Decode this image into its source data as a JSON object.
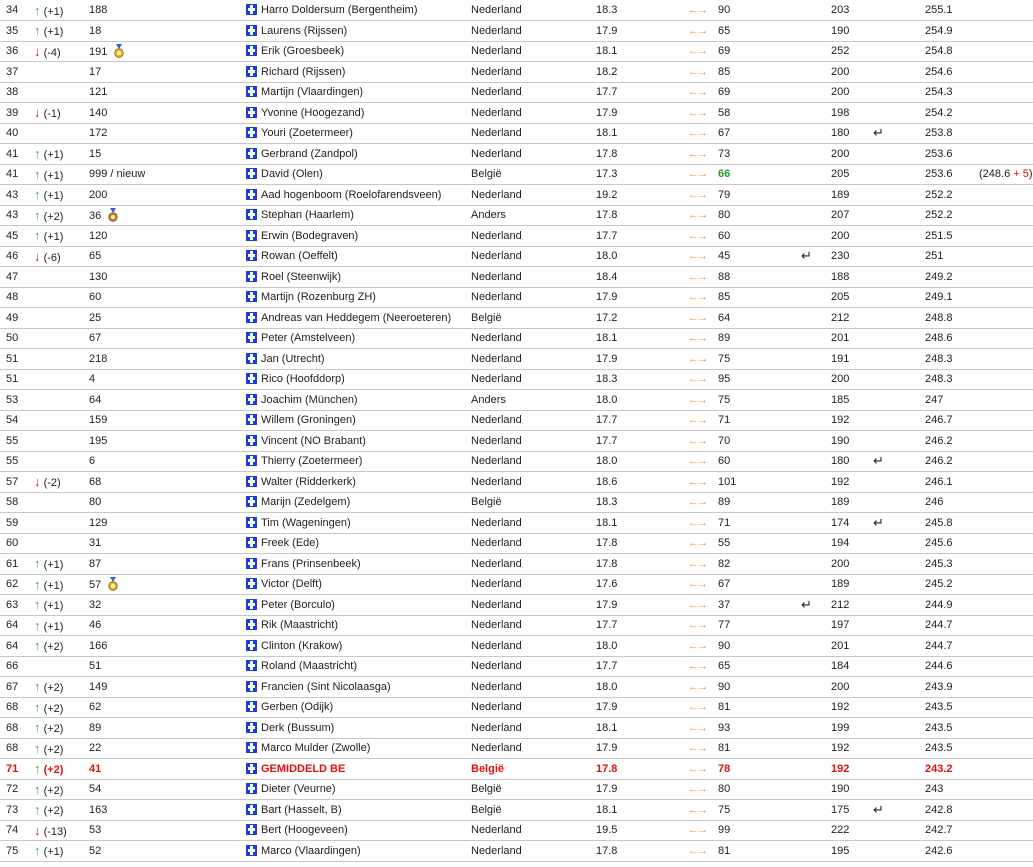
{
  "icons": {
    "up": "arrow-up-icon",
    "down": "arrow-down-icon",
    "flag": "flag-icon",
    "swap": "swap-arrows-icon",
    "return": "return-icon",
    "medal": "medal-icon"
  },
  "colors": {
    "up": "#3db43d",
    "down": "#d42020",
    "highlight": "#e01010",
    "swap": "#f29322",
    "flag": "#1b3fd6"
  },
  "rows": [
    {
      "rank": "34",
      "dir": "up",
      "change": "(+1)",
      "num": "188",
      "medal": "",
      "name": "Harro Doldersum (Bergentheim)",
      "country": "Nederland",
      "v1": "18.3",
      "v2": "90",
      "ret1": false,
      "v3": "203",
      "ret2": false,
      "score": "255.1",
      "extra": "",
      "hl": false
    },
    {
      "rank": "35",
      "dir": "up",
      "change": "(+1)",
      "num": "18",
      "medal": "",
      "name": "Laurens (Rijssen)",
      "country": "Nederland",
      "v1": "17.9",
      "v2": "65",
      "ret1": false,
      "v3": "190",
      "ret2": false,
      "score": "254.9",
      "extra": "",
      "hl": false
    },
    {
      "rank": "36",
      "dir": "down",
      "change": "(-4)",
      "num": "191",
      "medal": "gold",
      "name": "Erik (Groesbeek)",
      "country": "Nederland",
      "v1": "18.1",
      "v2": "69",
      "ret1": false,
      "v3": "252",
      "ret2": false,
      "score": "254.8",
      "extra": "",
      "hl": false
    },
    {
      "rank": "37",
      "dir": "",
      "change": "",
      "num": "17",
      "medal": "",
      "name": "Richard (Rijssen)",
      "country": "Nederland",
      "v1": "18.2",
      "v2": "85",
      "ret1": false,
      "v3": "200",
      "ret2": false,
      "score": "254.6",
      "extra": "",
      "hl": false
    },
    {
      "rank": "38",
      "dir": "",
      "change": "",
      "num": "121",
      "medal": "",
      "name": "Martijn (Vlaardingen)",
      "country": "Nederland",
      "v1": "17.7",
      "v2": "69",
      "ret1": false,
      "v3": "200",
      "ret2": false,
      "score": "254.3",
      "extra": "",
      "hl": false
    },
    {
      "rank": "39",
      "dir": "down",
      "change": "(-1)",
      "num": "140",
      "medal": "",
      "name": "Yvonne (Hoogezand)",
      "country": "Nederland",
      "v1": "17.9",
      "v2": "58",
      "ret1": false,
      "v3": "198",
      "ret2": false,
      "score": "254.2",
      "extra": "",
      "hl": false
    },
    {
      "rank": "40",
      "dir": "",
      "change": "",
      "num": "172",
      "medal": "",
      "name": "Youri (Zoetermeer)",
      "country": "Nederland",
      "v1": "18.1",
      "v2": "67",
      "ret1": false,
      "v3": "180",
      "ret2": true,
      "score": "253.8",
      "extra": "",
      "hl": false
    },
    {
      "rank": "41",
      "dir": "up",
      "change": "(+1)",
      "num": "15",
      "medal": "",
      "name": "Gerbrand (Zandpol)",
      "country": "Nederland",
      "v1": "17.8",
      "v2": "73",
      "ret1": false,
      "v3": "200",
      "ret2": false,
      "score": "253.6",
      "extra": "",
      "hl": false
    },
    {
      "rank": "41",
      "dir": "up",
      "change": "(+1)",
      "num": "999 / nieuw",
      "medal": "",
      "name": "David (Olen)",
      "country": "België",
      "v1": "17.3",
      "v2": "66",
      "ret1": false,
      "v3": "205",
      "ret2": false,
      "score": "253.6",
      "extra": "(248.6 + 5)",
      "hl": false,
      "v2green": true
    },
    {
      "rank": "43",
      "dir": "up",
      "change": "(+1)",
      "num": "200",
      "medal": "",
      "name": "Aad hogenboom (Roelofarendsveen)",
      "country": "Nederland",
      "v1": "19.2",
      "v2": "79",
      "ret1": false,
      "v3": "189",
      "ret2": false,
      "score": "252.2",
      "extra": "",
      "hl": false
    },
    {
      "rank": "43",
      "dir": "up",
      "change": "(+2)",
      "num": "36",
      "medal": "bronze",
      "name": "Stephan (Haarlem)",
      "country": "Anders",
      "v1": "17.8",
      "v2": "80",
      "ret1": false,
      "v3": "207",
      "ret2": false,
      "score": "252.2",
      "extra": "",
      "hl": false
    },
    {
      "rank": "45",
      "dir": "up",
      "change": "(+1)",
      "num": "120",
      "medal": "",
      "name": "Erwin (Bodegraven)",
      "country": "Nederland",
      "v1": "17.7",
      "v2": "60",
      "ret1": false,
      "v3": "200",
      "ret2": false,
      "score": "251.5",
      "extra": "",
      "hl": false
    },
    {
      "rank": "46",
      "dir": "down",
      "change": "(-6)",
      "num": "65",
      "medal": "",
      "name": "Rowan (Oeffelt)",
      "country": "Nederland",
      "v1": "18.0",
      "v2": "45",
      "ret1": true,
      "v3": "230",
      "ret2": false,
      "score": "251",
      "extra": "",
      "hl": false
    },
    {
      "rank": "47",
      "dir": "",
      "change": "",
      "num": "130",
      "medal": "",
      "name": "Roel (Steenwijk)",
      "country": "Nederland",
      "v1": "18.4",
      "v2": "88",
      "ret1": false,
      "v3": "188",
      "ret2": false,
      "score": "249.2",
      "extra": "",
      "hl": false
    },
    {
      "rank": "48",
      "dir": "",
      "change": "",
      "num": "60",
      "medal": "",
      "name": "Martijn (Rozenburg ZH)",
      "country": "Nederland",
      "v1": "17.9",
      "v2": "85",
      "ret1": false,
      "v3": "205",
      "ret2": false,
      "score": "249.1",
      "extra": "",
      "hl": false
    },
    {
      "rank": "49",
      "dir": "",
      "change": "",
      "num": "25",
      "medal": "",
      "name": "Andreas van Heddegem (Neeroeteren)",
      "country": "België",
      "v1": "17.2",
      "v2": "64",
      "ret1": false,
      "v3": "212",
      "ret2": false,
      "score": "248.8",
      "extra": "",
      "hl": false
    },
    {
      "rank": "50",
      "dir": "",
      "change": "",
      "num": "67",
      "medal": "",
      "name": "Peter (Amstelveen)",
      "country": "Nederland",
      "v1": "18.1",
      "v2": "89",
      "ret1": false,
      "v3": "201",
      "ret2": false,
      "score": "248.6",
      "extra": "",
      "hl": false
    },
    {
      "rank": "51",
      "dir": "",
      "change": "",
      "num": "218",
      "medal": "",
      "name": "Jan (Utrecht)",
      "country": "Nederland",
      "v1": "17.9",
      "v2": "75",
      "ret1": false,
      "v3": "191",
      "ret2": false,
      "score": "248.3",
      "extra": "",
      "hl": false
    },
    {
      "rank": "51",
      "dir": "",
      "change": "",
      "num": "4",
      "medal": "",
      "name": "Rico (Hoofddorp)",
      "country": "Nederland",
      "v1": "18.3",
      "v2": "95",
      "ret1": false,
      "v3": "200",
      "ret2": false,
      "score": "248.3",
      "extra": "",
      "hl": false
    },
    {
      "rank": "53",
      "dir": "",
      "change": "",
      "num": "64",
      "medal": "",
      "name": "Joachim (München)",
      "country": "Anders",
      "v1": "18.0",
      "v2": "75",
      "ret1": false,
      "v3": "185",
      "ret2": false,
      "score": "247",
      "extra": "",
      "hl": false
    },
    {
      "rank": "54",
      "dir": "",
      "change": "",
      "num": "159",
      "medal": "",
      "name": "Willem (Groningen)",
      "country": "Nederland",
      "v1": "17.7",
      "v2": "71",
      "ret1": false,
      "v3": "192",
      "ret2": false,
      "score": "246.7",
      "extra": "",
      "hl": false
    },
    {
      "rank": "55",
      "dir": "",
      "change": "",
      "num": "195",
      "medal": "",
      "name": "Vincent (NO Brabant)",
      "country": "Nederland",
      "v1": "17.7",
      "v2": "70",
      "ret1": false,
      "v3": "190",
      "ret2": false,
      "score": "246.2",
      "extra": "",
      "hl": false
    },
    {
      "rank": "55",
      "dir": "",
      "change": "",
      "num": "6",
      "medal": "",
      "name": "Thierry (Zoetermeer)",
      "country": "Nederland",
      "v1": "18.0",
      "v2": "60",
      "ret1": false,
      "v3": "180",
      "ret2": true,
      "score": "246.2",
      "extra": "",
      "hl": false
    },
    {
      "rank": "57",
      "dir": "down",
      "change": "(-2)",
      "num": "68",
      "medal": "",
      "name": "Walter (Ridderkerk)",
      "country": "Nederland",
      "v1": "18.6",
      "v2": "101",
      "ret1": false,
      "v3": "192",
      "ret2": false,
      "score": "246.1",
      "extra": "",
      "hl": false
    },
    {
      "rank": "58",
      "dir": "",
      "change": "",
      "num": "80",
      "medal": "",
      "name": "Marijn (Zedelgem)",
      "country": "België",
      "v1": "18.3",
      "v2": "89",
      "ret1": false,
      "v3": "189",
      "ret2": false,
      "score": "246",
      "extra": "",
      "hl": false
    },
    {
      "rank": "59",
      "dir": "",
      "change": "",
      "num": "129",
      "medal": "",
      "name": "Tim (Wageningen)",
      "country": "Nederland",
      "v1": "18.1",
      "v2": "71",
      "ret1": false,
      "v3": "174",
      "ret2": true,
      "score": "245.8",
      "extra": "",
      "hl": false
    },
    {
      "rank": "60",
      "dir": "",
      "change": "",
      "num": "31",
      "medal": "",
      "name": "Freek (Ede)",
      "country": "Nederland",
      "v1": "17.8",
      "v2": "55",
      "ret1": false,
      "v3": "194",
      "ret2": false,
      "score": "245.6",
      "extra": "",
      "hl": false
    },
    {
      "rank": "61",
      "dir": "up",
      "change": "(+1)",
      "num": "87",
      "medal": "",
      "name": "Frans (Prinsenbeek)",
      "country": "Nederland",
      "v1": "17.8",
      "v2": "82",
      "ret1": false,
      "v3": "200",
      "ret2": false,
      "score": "245.3",
      "extra": "",
      "hl": false
    },
    {
      "rank": "62",
      "dir": "up",
      "change": "(+1)",
      "num": "57",
      "medal": "gold",
      "name": "Victor (Delft)",
      "country": "Nederland",
      "v1": "17.6",
      "v2": "67",
      "ret1": false,
      "v3": "189",
      "ret2": false,
      "score": "245.2",
      "extra": "",
      "hl": false
    },
    {
      "rank": "63",
      "dir": "up",
      "change": "(+1)",
      "num": "32",
      "medal": "",
      "name": "Peter (Borculo)",
      "country": "Nederland",
      "v1": "17.9",
      "v2": "37",
      "ret1": true,
      "v3": "212",
      "ret2": false,
      "score": "244.9",
      "extra": "",
      "hl": false
    },
    {
      "rank": "64",
      "dir": "up",
      "change": "(+1)",
      "num": "46",
      "medal": "",
      "name": "Rik (Maastricht)",
      "country": "Nederland",
      "v1": "17.7",
      "v2": "77",
      "ret1": false,
      "v3": "197",
      "ret2": false,
      "score": "244.7",
      "extra": "",
      "hl": false
    },
    {
      "rank": "64",
      "dir": "up",
      "change": "(+2)",
      "num": "166",
      "medal": "",
      "name": "Clinton (Krakow)",
      "country": "Nederland",
      "v1": "18.0",
      "v2": "90",
      "ret1": false,
      "v3": "201",
      "ret2": false,
      "score": "244.7",
      "extra": "",
      "hl": false
    },
    {
      "rank": "66",
      "dir": "",
      "change": "",
      "num": "51",
      "medal": "",
      "name": "Roland (Maastricht)",
      "country": "Nederland",
      "v1": "17.7",
      "v2": "65",
      "ret1": false,
      "v3": "184",
      "ret2": false,
      "score": "244.6",
      "extra": "",
      "hl": false
    },
    {
      "rank": "67",
      "dir": "up",
      "change": "(+2)",
      "num": "149",
      "medal": "",
      "name": "Francien (Sint Nicolaasga)",
      "country": "Nederland",
      "v1": "18.0",
      "v2": "90",
      "ret1": false,
      "v3": "200",
      "ret2": false,
      "score": "243.9",
      "extra": "",
      "hl": false
    },
    {
      "rank": "68",
      "dir": "up",
      "change": "(+2)",
      "num": "62",
      "medal": "",
      "name": "Gerben (Odijk)",
      "country": "Nederland",
      "v1": "17.9",
      "v2": "81",
      "ret1": false,
      "v3": "192",
      "ret2": false,
      "score": "243.5",
      "extra": "",
      "hl": false
    },
    {
      "rank": "68",
      "dir": "up",
      "change": "(+2)",
      "num": "89",
      "medal": "",
      "name": "Derk (Bussum)",
      "country": "Nederland",
      "v1": "18.1",
      "v2": "93",
      "ret1": false,
      "v3": "199",
      "ret2": false,
      "score": "243.5",
      "extra": "",
      "hl": false
    },
    {
      "rank": "68",
      "dir": "up",
      "change": "(+2)",
      "num": "22",
      "medal": "",
      "name": "Marco Mulder (Zwolle)",
      "country": "Nederland",
      "v1": "17.9",
      "v2": "81",
      "ret1": false,
      "v3": "192",
      "ret2": false,
      "score": "243.5",
      "extra": "",
      "hl": false
    },
    {
      "rank": "71",
      "dir": "up",
      "change": "(+2)",
      "num": "41",
      "medal": "",
      "name": "GEMIDDELD BE",
      "country": "België",
      "v1": "17.8",
      "v2": "78",
      "ret1": false,
      "v3": "192",
      "ret2": false,
      "score": "243.2",
      "extra": "",
      "hl": true
    },
    {
      "rank": "72",
      "dir": "up",
      "change": "(+2)",
      "num": "54",
      "medal": "",
      "name": "Dieter (Veurne)",
      "country": "België",
      "v1": "17.9",
      "v2": "80",
      "ret1": false,
      "v3": "190",
      "ret2": false,
      "score": "243",
      "extra": "",
      "hl": false
    },
    {
      "rank": "73",
      "dir": "up",
      "change": "(+2)",
      "num": "163",
      "medal": "",
      "name": "Bart (Hasselt, B)",
      "country": "België",
      "v1": "18.1",
      "v2": "75",
      "ret1": false,
      "v3": "175",
      "ret2": true,
      "score": "242.8",
      "extra": "",
      "hl": false
    },
    {
      "rank": "74",
      "dir": "down",
      "change": "(-13)",
      "num": "53",
      "medal": "",
      "name": "Bert (Hoogeveen)",
      "country": "Nederland",
      "v1": "19.5",
      "v2": "99",
      "ret1": false,
      "v3": "222",
      "ret2": false,
      "score": "242.7",
      "extra": "",
      "hl": false
    },
    {
      "rank": "75",
      "dir": "up",
      "change": "(+1)",
      "num": "52",
      "medal": "",
      "name": "Marco (Vlaardingen)",
      "country": "Nederland",
      "v1": "17.8",
      "v2": "81",
      "ret1": false,
      "v3": "195",
      "ret2": false,
      "score": "242.6",
      "extra": "",
      "hl": false
    }
  ]
}
